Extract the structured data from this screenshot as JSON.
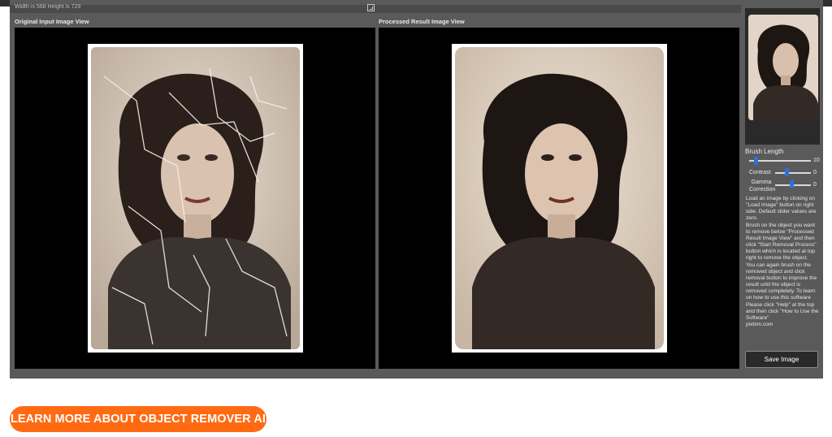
{
  "app": {
    "dimensions_text": "Width is 568 Height is 729",
    "left_view_title": "Original Input Image View",
    "right_view_title": "Processed Result Image View"
  },
  "sidebar": {
    "brush_length_label": "Brush Length",
    "brush_length_value": "10",
    "contrast_label": "Contrast",
    "contrast_value": "0",
    "gamma_label": "Gamma\nCorrection",
    "gamma_value": "0",
    "help_text": "Load an image by clicking on \"Load Image\" button on right side. Default slider values are zero.\nBrush on the object you want to remove below \"Processed Result Image View\" and then click \"Start Removal Process\" button which is located at top right to remove the object.\n You can again brush on the removed object and click removal button to improve the result until the object is removed completely. To learn on how to use this software Please click \"Help\" at the top and then click \"How to Use the Software\"\npixbim.com",
    "save_button_label": "Save Image"
  },
  "cta": {
    "label": "LEARN MORE ABOUT OBJECT REMOVER AI"
  },
  "colors": {
    "app_bg": "#5a5a5a",
    "view_bg": "#000000",
    "slider_knob": "#2f6fd6",
    "cta_bg": "#ff6a13"
  },
  "icons": {
    "crop": "crop-icon"
  }
}
